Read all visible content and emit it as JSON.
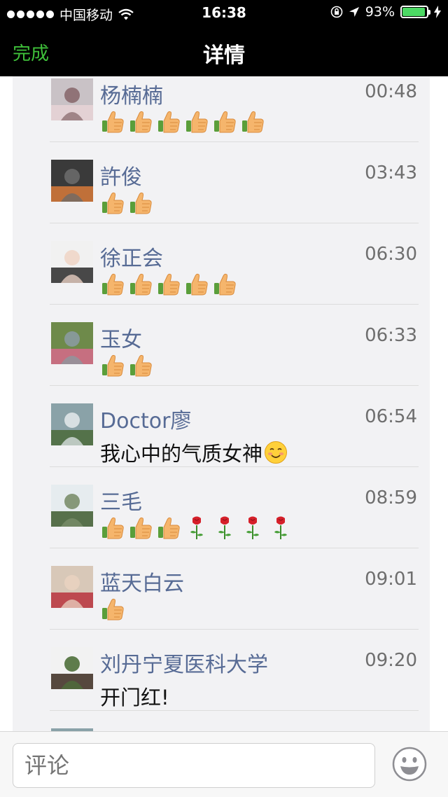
{
  "status": {
    "carrier": "中国移动",
    "time": "16:38",
    "battery_percent_label": "93%",
    "battery_level": 0.93,
    "battery_color": "#4cd964"
  },
  "nav": {
    "done_label": "完成",
    "title": "详情",
    "accent_color": "#3fc03a"
  },
  "comments": [
    {
      "name": "杨楠楠",
      "time": "00:48",
      "text": "",
      "emoji": {
        "thumbs": 6,
        "roses": 0,
        "smile": false
      }
    },
    {
      "name": "許俊",
      "time": "03:43",
      "text": "",
      "emoji": {
        "thumbs": 2,
        "roses": 0,
        "smile": false
      }
    },
    {
      "name": "徐正会",
      "time": "06:30",
      "text": "",
      "emoji": {
        "thumbs": 5,
        "roses": 0,
        "smile": false
      }
    },
    {
      "name": "玉女",
      "time": "06:33",
      "text": "",
      "emoji": {
        "thumbs": 2,
        "roses": 0,
        "smile": false
      }
    },
    {
      "name": "Doctor廖",
      "time": "06:54",
      "text": "我心中的气质女神",
      "emoji": {
        "thumbs": 0,
        "roses": 0,
        "smile": true
      }
    },
    {
      "name": "三毛",
      "time": "08:59",
      "text": "",
      "emoji": {
        "thumbs": 3,
        "roses": 4,
        "smile": false
      }
    },
    {
      "name": "蓝天白云",
      "time": "09:01",
      "text": "",
      "emoji": {
        "thumbs": 1,
        "roses": 0,
        "smile": false
      }
    },
    {
      "name": "刘丹宁夏医科大学",
      "time": "09:20",
      "text": "开门红!",
      "emoji": {
        "thumbs": 0,
        "roses": 0,
        "smile": false
      }
    }
  ],
  "comment_bar": {
    "placeholder": "评论",
    "emoji_button_icon": "smiley-face-icon"
  },
  "colors": {
    "name_link": "#576b95",
    "list_background": "#f2f2f4"
  }
}
